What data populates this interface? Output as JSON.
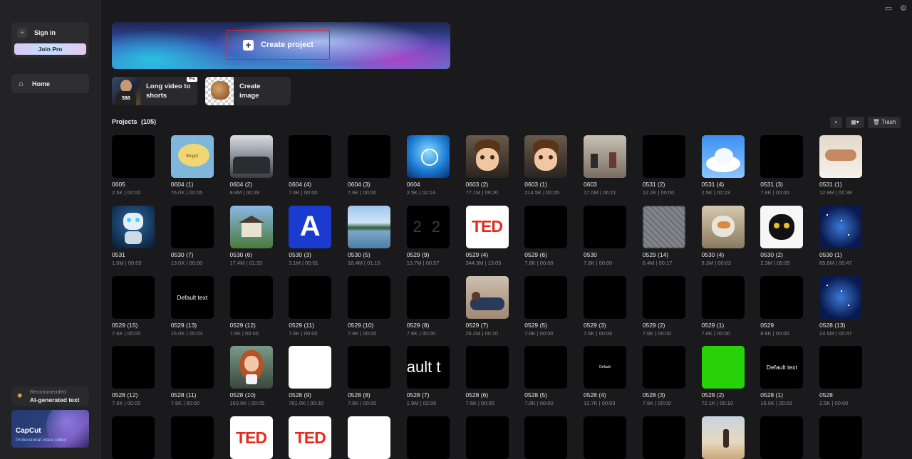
{
  "sidebar": {
    "sign_in": "Sign in",
    "join_pro": "Join Pro",
    "home": "Home",
    "recommended_label": "Recommended",
    "recommended_feature": "AI-generated text",
    "promo_title": "CapCut",
    "promo_subtitle": "Professional video editor"
  },
  "banner": {
    "create_project": "Create project"
  },
  "quick_actions": [
    {
      "label": "Long video to shorts",
      "badge": "Pro",
      "thumb_text": "588"
    },
    {
      "label": "Create image"
    }
  ],
  "projects": {
    "title": "Projects",
    "count": "(105)",
    "trash": "Trash",
    "items": [
      {
        "name": "0605",
        "meta": "2.5K | 00:00",
        "thumb": "black"
      },
      {
        "name": "0604 (1)",
        "meta": "76.0K | 00:05",
        "thumb": "speech"
      },
      {
        "name": "0604 (2)",
        "meta": "9.8M | 00:28",
        "thumb": "car"
      },
      {
        "name": "0604 (4)",
        "meta": "7.6K | 00:00",
        "thumb": "black"
      },
      {
        "name": "0604 (3)",
        "meta": "7.6K | 00:00",
        "thumb": "black"
      },
      {
        "name": "0604",
        "meta": "2.5K | 02:14",
        "thumb": "bluetech"
      },
      {
        "name": "0603 (2)",
        "meta": "77.1M | 09:20",
        "thumb": "cartoon"
      },
      {
        "name": "0603 (1)",
        "meta": "214.5K | 00:05",
        "thumb": "cartoon"
      },
      {
        "name": "0603",
        "meta": "17.0M | 06:21",
        "thumb": "room"
      },
      {
        "name": "0531 (2)",
        "meta": "12.2K | 00:00",
        "thumb": "black"
      },
      {
        "name": "0531 (4)",
        "meta": "2.5K | 00:23",
        "thumb": "cloud"
      },
      {
        "name": "0531 (3)",
        "meta": "7.6K | 00:00",
        "thumb": "black"
      },
      {
        "name": "0531 (1)",
        "meta": "12.9M | 00:38",
        "thumb": "bed"
      },
      {
        "name": "0531",
        "meta": "1.0M | 00:05",
        "thumb": "robot"
      },
      {
        "name": "0530 (7)",
        "meta": "13.0K | 00:00",
        "thumb": "black"
      },
      {
        "name": "0530 (6)",
        "meta": "17.4M | 01:33",
        "thumb": "house"
      },
      {
        "name": "0530 (3)",
        "meta": "3.1M | 00:01",
        "thumb": "letterA"
      },
      {
        "name": "0530 (5)",
        "meta": "18.4M | 01:10",
        "thumb": "lake"
      },
      {
        "name": "0529 (9)",
        "meta": "13.7M | 00:57",
        "thumb": "numbers"
      },
      {
        "name": "0529 (4)",
        "meta": "344.3M | 13:05",
        "thumb": "ted"
      },
      {
        "name": "0529 (6)",
        "meta": "7.6K | 00:00",
        "thumb": "black"
      },
      {
        "name": "0530",
        "meta": "7.6K | 00:00",
        "thumb": "black"
      },
      {
        "name": "0529 (14)",
        "meta": "6.4M | 00:17",
        "thumb": "blur"
      },
      {
        "name": "0530 (4)",
        "meta": "9.3M | 00:02",
        "thumb": "catphoto"
      },
      {
        "name": "0530 (2)",
        "meta": "2.3M | 00:05",
        "thumb": "catdraw"
      },
      {
        "name": "0530 (1)",
        "meta": "65.8M | 00:47",
        "thumb": "space"
      },
      {
        "name": "0529 (15)",
        "meta": "7.6K | 00:00",
        "thumb": "black"
      },
      {
        "name": "0529 (13)",
        "meta": "16.0K | 00:03",
        "thumb": "defaulttext"
      },
      {
        "name": "0529 (12)",
        "meta": "7.6K | 00:00",
        "thumb": "black"
      },
      {
        "name": "0529 (11)",
        "meta": "7.6K | 00:00",
        "thumb": "black"
      },
      {
        "name": "0529 (10)",
        "meta": "7.6K | 00:00",
        "thumb": "black"
      },
      {
        "name": "0529 (8)",
        "meta": "7.6K | 00:00",
        "thumb": "black"
      },
      {
        "name": "0529 (7)",
        "meta": "26.2M | 00:10",
        "thumb": "person"
      },
      {
        "name": "0529 (5)",
        "meta": "7.6K | 00:00",
        "thumb": "black"
      },
      {
        "name": "0529 (3)",
        "meta": "7.6K | 00:00",
        "thumb": "black"
      },
      {
        "name": "0529 (2)",
        "meta": "7.6K | 00:00",
        "thumb": "black"
      },
      {
        "name": "0529 (1)",
        "meta": "7.6K | 00:00",
        "thumb": "black"
      },
      {
        "name": "0529",
        "meta": "8.6K | 00:00",
        "thumb": "black"
      },
      {
        "name": "0528 (13)",
        "meta": "24.5M | 00:47",
        "thumb": "space"
      },
      {
        "name": "0528 (12)",
        "meta": "7.6K | 00:00",
        "thumb": "black"
      },
      {
        "name": "0528 (11)",
        "meta": "7.6K | 00:00",
        "thumb": "black"
      },
      {
        "name": "0528 (10)",
        "meta": "160.0K | 00:05",
        "thumb": "woman"
      },
      {
        "name": "0528 (9)",
        "meta": "761.0K | 00:30",
        "thumb": "white"
      },
      {
        "name": "0528 (8)",
        "meta": "7.6K | 00:00",
        "thumb": "black"
      },
      {
        "name": "0528 (7)",
        "meta": "1.9M | 02:06",
        "thumb": "aultt"
      },
      {
        "name": "0528 (6)",
        "meta": "7.6K | 00:00",
        "thumb": "black"
      },
      {
        "name": "0528 (5)",
        "meta": "7.6K | 00:00",
        "thumb": "black"
      },
      {
        "name": "0528 (4)",
        "meta": "13.7K | 00:03",
        "thumb": "smalltext"
      },
      {
        "name": "0528 (3)",
        "meta": "7.6K | 00:00",
        "thumb": "black"
      },
      {
        "name": "0528 (2)",
        "meta": "72.1K | 00:10",
        "thumb": "green"
      },
      {
        "name": "0528 (1)",
        "meta": "16.0K | 00:03",
        "thumb": "defaulttext"
      },
      {
        "name": "0528",
        "meta": "2.5K | 00:00",
        "thumb": "black"
      },
      {
        "name": "",
        "meta": "",
        "thumb": "black"
      },
      {
        "name": "",
        "meta": "",
        "thumb": "black"
      },
      {
        "name": "",
        "meta": "",
        "thumb": "ted"
      },
      {
        "name": "",
        "meta": "",
        "thumb": "ted"
      },
      {
        "name": "",
        "meta": "",
        "thumb": "white"
      },
      {
        "name": "",
        "meta": "",
        "thumb": "black"
      },
      {
        "name": "",
        "meta": "",
        "thumb": "black"
      },
      {
        "name": "",
        "meta": "",
        "thumb": "black"
      },
      {
        "name": "",
        "meta": "",
        "thumb": "black"
      },
      {
        "name": "",
        "meta": "",
        "thumb": "black"
      },
      {
        "name": "",
        "meta": "",
        "thumb": "beach"
      },
      {
        "name": "",
        "meta": "",
        "thumb": "black"
      },
      {
        "name": "",
        "meta": "",
        "thumb": "black"
      }
    ]
  },
  "thumb_text": {
    "ted": "TED",
    "default_text": "Default text",
    "ault_t": "ault t",
    "small_text": "Default",
    "numbers": "2  2",
    "letter_a": "A",
    "speech": "Bingo!"
  },
  "colors": {
    "background": "#1a1a1c",
    "sidebar": "#232325",
    "highlight_border": "#e0262b",
    "ted_red": "#e62b1e",
    "green_screen": "#27d308"
  }
}
